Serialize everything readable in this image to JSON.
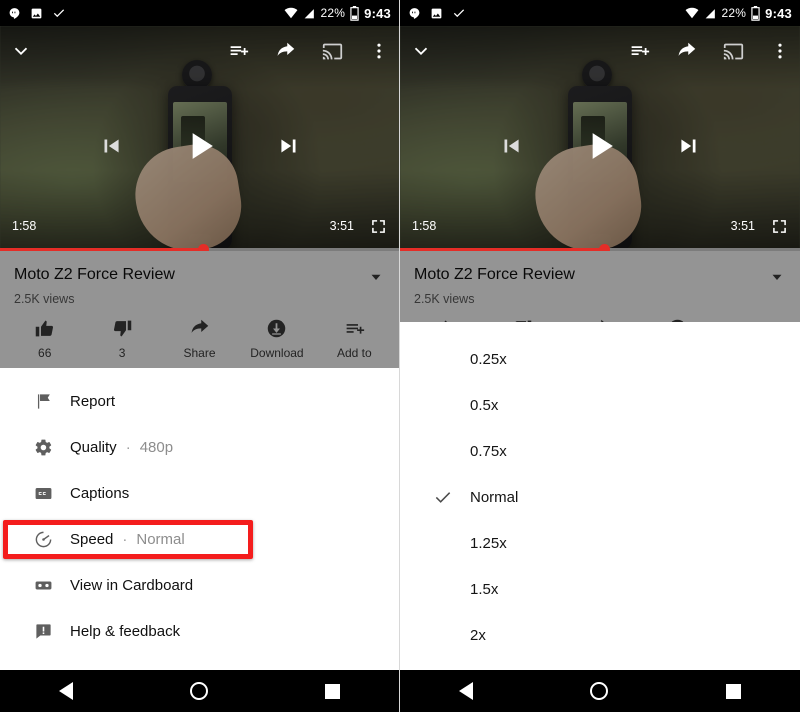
{
  "status_bar": {
    "icons_left": [
      "hangouts-icon",
      "photo-icon",
      "check-icon"
    ],
    "wifi_icon": "wifi-icon",
    "signal_icon": "signal-icon",
    "battery_percent": "22%",
    "battery_icon": "battery-icon",
    "time": "9:43"
  },
  "player": {
    "collapse_icon": "chevron-down-icon",
    "queue_icon": "add-to-queue-icon",
    "share_icon": "share-icon",
    "cast_icon": "cast-icon",
    "overflow_icon": "more-vertical-icon",
    "prev_icon": "previous-icon",
    "play_icon": "play-icon",
    "next_icon": "next-icon",
    "current_time": "1:58",
    "duration": "3:51",
    "fullscreen_icon": "fullscreen-icon",
    "progress_percent": 51,
    "progress_color": "#e52d27"
  },
  "video_info": {
    "title": "Moto Z2 Force Review",
    "views": "2.5K views",
    "expand_icon": "chevron-down-icon",
    "actions": [
      {
        "icon": "thumbs-up-icon",
        "label": "66"
      },
      {
        "icon": "thumbs-down-icon",
        "label": "3"
      },
      {
        "icon": "share-icon",
        "label": "Share"
      },
      {
        "icon": "download-icon",
        "label": "Download"
      },
      {
        "icon": "add-to-playlist-icon",
        "label": "Add to"
      }
    ]
  },
  "menu": {
    "items": [
      {
        "icon": "flag-icon",
        "label": "Report",
        "value": ""
      },
      {
        "icon": "gear-icon",
        "label": "Quality",
        "separator": "·",
        "value": "480p"
      },
      {
        "icon": "closed-captions-icon",
        "label": "Captions",
        "value": ""
      },
      {
        "icon": "speedometer-icon",
        "label": "Speed",
        "separator": "·",
        "value": "Normal"
      },
      {
        "icon": "cardboard-icon",
        "label": "View in Cardboard",
        "value": ""
      },
      {
        "icon": "help-feedback-icon",
        "label": "Help & feedback",
        "value": ""
      }
    ],
    "highlight_color": "#f41d1d",
    "highlighted_item": "Speed"
  },
  "speed_dialog": {
    "options": [
      {
        "label": "0.25x",
        "selected": false
      },
      {
        "label": "0.5x",
        "selected": false
      },
      {
        "label": "0.75x",
        "selected": false
      },
      {
        "label": "Normal",
        "selected": true
      },
      {
        "label": "1.25x",
        "selected": false
      },
      {
        "label": "1.5x",
        "selected": false
      },
      {
        "label": "2x",
        "selected": false
      }
    ],
    "check_icon": "check-icon"
  },
  "nav_bar": {
    "back_icon": "back-triangle-icon",
    "home_icon": "home-circle-icon",
    "recents_icon": "recents-square-icon"
  }
}
